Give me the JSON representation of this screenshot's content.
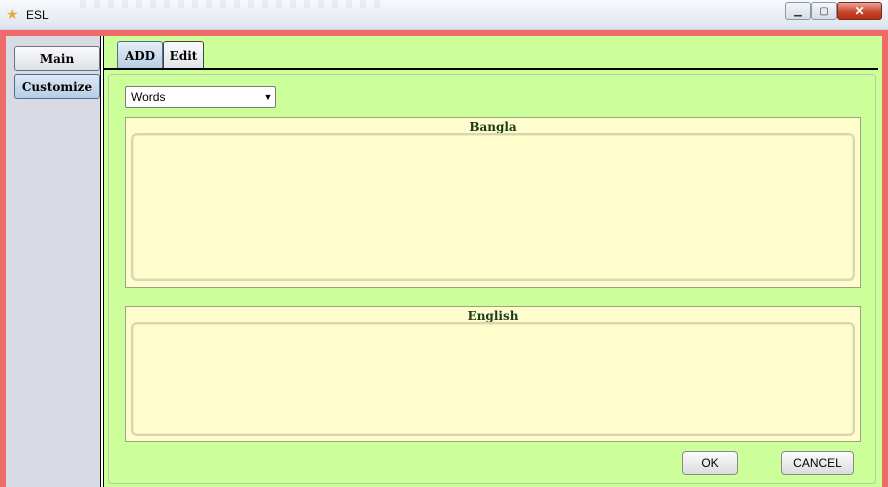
{
  "window": {
    "title": "ESL",
    "icon": "star-icon"
  },
  "sidebar": {
    "tabs": [
      {
        "label": "Main"
      },
      {
        "label": "Customize"
      }
    ],
    "selected": "Customize"
  },
  "tabs": [
    {
      "label": "ADD"
    },
    {
      "label": "Edit"
    }
  ],
  "selected_tab": "ADD",
  "form": {
    "type_select": {
      "value": "Words"
    },
    "bangla": {
      "title": "Bangla",
      "value": ""
    },
    "english": {
      "title": "English",
      "value": ""
    },
    "ok_label": "OK",
    "cancel_label": "CANCEL"
  },
  "colors": {
    "frame": "#ed6b68",
    "panel": "#ccfe9a",
    "textarea": "#fffdcc",
    "sidebar": "#d8dbe4"
  }
}
